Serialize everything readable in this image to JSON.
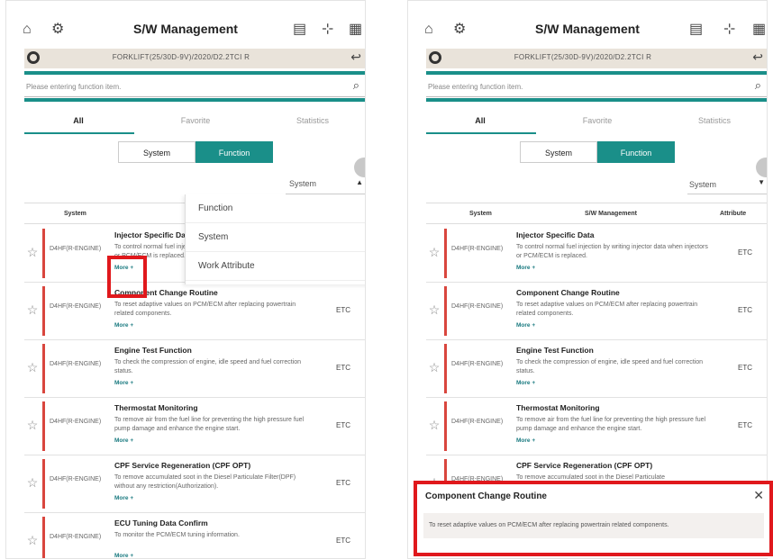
{
  "app": {
    "title": "S/W Management",
    "vehicle": "FORKLIFT(25/30D-9V)/2020/D2.2TCI R",
    "search_placeholder": "Please entering function item.",
    "tabs": [
      "All",
      "Favorite",
      "Statistics"
    ],
    "segment": [
      "System",
      "Function"
    ],
    "system_dropdown": "System",
    "table_headers": {
      "system": "System",
      "swmgmt": "S/W Management",
      "attribute": "Attribute"
    },
    "more_label": "More +"
  },
  "left_dropdown": [
    "Function",
    "System",
    "Work Attribute"
  ],
  "left_rows": [
    {
      "system": "D4HF(R-ENGINE)",
      "title": "Injector Specific Data",
      "desc": "To control normal fuel injection by writing injector data when injectors or PCM/ECM is replaced.",
      "attr": "ETC"
    },
    {
      "system": "D4HF(R-ENGINE)",
      "title": "Component Change Routine",
      "desc": "To reset adaptive values on PCM/ECM after replacing powertrain related components.",
      "attr": "ETC"
    },
    {
      "system": "D4HF(R-ENGINE)",
      "title": "Engine Test Function",
      "desc": "To check the compression of engine, idle speed and fuel correction status.",
      "attr": "ETC"
    },
    {
      "system": "D4HF(R-ENGINE)",
      "title": "Thermostat Monitoring",
      "desc": "To remove air from the fuel line for preventing the high pressure fuel pump damage and enhance the engine start.",
      "attr": "ETC"
    },
    {
      "system": "D4HF(R-ENGINE)",
      "title": "CPF Service Regeneration (CPF OPT)",
      "desc": "To remove accumulated soot in the Diesel Particulate Filter(DPF) without any restriction(Authorization).",
      "attr": "ETC"
    },
    {
      "system": "D4HF(R-ENGINE)",
      "title": "ECU Tuning Data Confirm",
      "desc": "To monitor the PCM/ECM tuning information.",
      "attr": "ETC"
    }
  ],
  "right_rows": [
    {
      "system": "D4HF(R-ENGINE)",
      "title": "Injector Specific Data",
      "desc": "To control normal fuel injection by writing injector data when injectors or PCM/ECM is replaced.",
      "attr": "ETC"
    },
    {
      "system": "D4HF(R-ENGINE)",
      "title": "Component Change Routine",
      "desc": "To reset adaptive values on PCM/ECM after replacing powertrain related components.",
      "attr": "ETC"
    },
    {
      "system": "D4HF(R-ENGINE)",
      "title": "Engine Test Function",
      "desc": "To check the compression of engine, idle speed and fuel correction status.",
      "attr": "ETC"
    },
    {
      "system": "D4HF(R-ENGINE)",
      "title": "Thermostat Monitoring",
      "desc": "To remove air from the fuel line for preventing the high pressure fuel pump damage and enhance the engine start.",
      "attr": "ETC"
    },
    {
      "system": "D4HF(R-ENGINE)",
      "title": "CPF Service Regeneration (CPF OPT)",
      "desc": "To remove accumulated soot in the Diesel Particulate",
      "attr": ""
    }
  ],
  "popup": {
    "title": "Component Change Routine",
    "body": "To reset adaptive values on PCM/ECM after replacing powertrain related components."
  },
  "colors": {
    "accent": "#1a8f89",
    "highlight": "#e0181c",
    "row_bar": "#d9463e"
  }
}
